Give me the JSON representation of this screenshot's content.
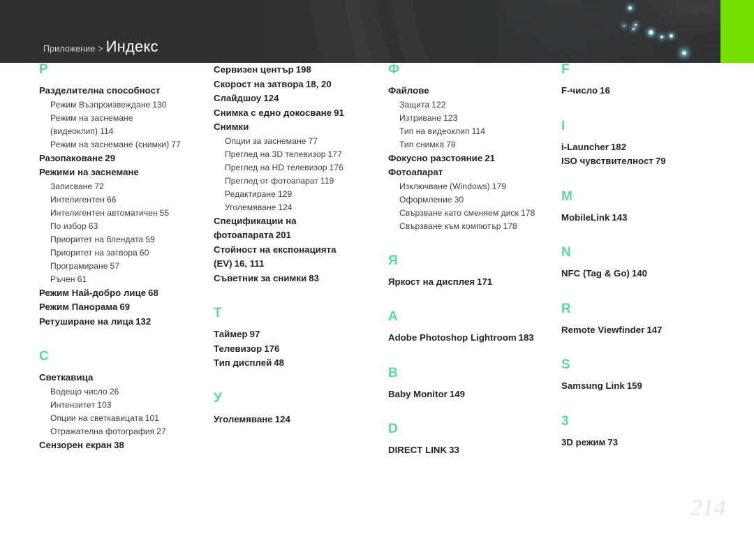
{
  "header": {
    "breadcrumb_parent": "Приложение",
    "breadcrumb_separator": ">",
    "breadcrumb_current": "Индекс",
    "accent_green": "#76e000",
    "background": "#303233"
  },
  "page_number": "214",
  "letter_color": "#5fd79b",
  "columns": [
    {
      "id": "column-1",
      "blocks": [
        {
          "letter": "Р",
          "entries": [
            {
              "label": "Разделителна способност",
              "page": ""
            },
            {
              "label": "Режим Възпроизвеждане",
              "page": "130",
              "sub": true
            },
            {
              "label": "Режим на заснемане",
              "page": "",
              "sub": true
            },
            {
              "label": "(видеоклип)",
              "page": "114",
              "sub": true
            },
            {
              "label": "Режим на заснемане (снимки)",
              "page": "77",
              "sub": true
            },
            {
              "label": "Разопаковане",
              "page": "29"
            },
            {
              "label": "Режими на заснемане",
              "page": ""
            },
            {
              "label": "Записване",
              "page": "72",
              "sub": true
            },
            {
              "label": "Интелигентен",
              "page": "66",
              "sub": true
            },
            {
              "label": "Интелигентен автоматичен",
              "page": "55",
              "sub": true
            },
            {
              "label": "По избор",
              "page": "63",
              "sub": true
            },
            {
              "label": "Приоритет на блендата",
              "page": "59",
              "sub": true
            },
            {
              "label": "Приоритет на затвора",
              "page": "60",
              "sub": true
            },
            {
              "label": "Програмиране",
              "page": "57",
              "sub": true
            },
            {
              "label": "Ръчен",
              "page": "61",
              "sub": true
            },
            {
              "label": "Режим Най-добро лице",
              "page": "68"
            },
            {
              "label": "Режим Панорама",
              "page": "69"
            },
            {
              "label": "Ретуширане на лица",
              "page": "132"
            }
          ]
        },
        {
          "letter": "С",
          "entries": [
            {
              "label": "Светкавица",
              "page": ""
            },
            {
              "label": "Водещо число",
              "page": "26",
              "sub": true
            },
            {
              "label": "Интензитет",
              "page": "103",
              "sub": true
            },
            {
              "label": "Опции на светкавицата",
              "page": "101",
              "sub": true
            },
            {
              "label": "Отражателна фотография",
              "page": "27",
              "sub": true
            },
            {
              "label": "Сензорен екран",
              "page": "38"
            }
          ]
        }
      ]
    },
    {
      "id": "column-2",
      "blocks": [
        {
          "letter": "",
          "entries": [
            {
              "label": "Сервизен център",
              "page": "198"
            },
            {
              "label": "Скорост на затвора",
              "page": "18, 20"
            },
            {
              "label": "Слайдшоу",
              "page": "124"
            },
            {
              "label": "Снимка с едно докосване",
              "page": "91"
            },
            {
              "label": "Снимки",
              "page": ""
            },
            {
              "label": "Опции за заснемане",
              "page": "77",
              "sub": true
            },
            {
              "label": "Преглед на 3D телевизор",
              "page": "177",
              "sub": true
            },
            {
              "label": "Преглед на HD телевизор",
              "page": "176",
              "sub": true
            },
            {
              "label": "Преглед от фотоапарат",
              "page": "119",
              "sub": true
            },
            {
              "label": "Редактиране",
              "page": "129",
              "sub": true
            },
            {
              "label": "Уголемяване",
              "page": "124",
              "sub": true
            },
            {
              "label": "Спецификации на",
              "page": ""
            },
            {
              "label": "фотоапарата",
              "page": "201"
            },
            {
              "label": "Стойност на експонацията",
              "page": ""
            },
            {
              "label": "(EV)",
              "page": "16, 111"
            },
            {
              "label": "Съветник за снимки",
              "page": "83"
            }
          ]
        },
        {
          "letter": "Т",
          "entries": [
            {
              "label": "Таймер",
              "page": "97"
            },
            {
              "label": "Телевизор",
              "page": "176"
            },
            {
              "label": "Тип дисплей",
              "page": "48"
            }
          ]
        },
        {
          "letter": "У",
          "entries": [
            {
              "label": "Уголемяване",
              "page": "124"
            }
          ]
        }
      ]
    },
    {
      "id": "column-3",
      "blocks": [
        {
          "letter": "Ф",
          "entries": [
            {
              "label": "Файлове",
              "page": ""
            },
            {
              "label": "Защита",
              "page": "122",
              "sub": true
            },
            {
              "label": "Изтриване",
              "page": "123",
              "sub": true
            },
            {
              "label": "Тип на видеоклип",
              "page": "114",
              "sub": true
            },
            {
              "label": "Тип снимка",
              "page": "78",
              "sub": true
            },
            {
              "label": "Фокусно разстояние",
              "page": "21"
            },
            {
              "label": "Фотоапарат",
              "page": ""
            },
            {
              "label": "Изключване (Windows)",
              "page": "179",
              "sub": true
            },
            {
              "label": "Оформление",
              "page": "30",
              "sub": true
            },
            {
              "label": "Свързване като сменяем диск",
              "page": "178",
              "sub": true
            },
            {
              "label": "Свързване към компютър",
              "page": "178",
              "sub": true
            }
          ]
        },
        {
          "letter": "Я",
          "entries": [
            {
              "label": "Яркост на дисплея",
              "page": "171"
            }
          ]
        },
        {
          "letter": "A",
          "entries": [
            {
              "label": "Adobe Photoshop Lightroom",
              "page": "183"
            }
          ]
        },
        {
          "letter": "B",
          "entries": [
            {
              "label": "Baby Monitor",
              "page": "149"
            }
          ]
        },
        {
          "letter": "D",
          "entries": [
            {
              "label": "DIRECT LINK",
              "page": "33"
            }
          ]
        }
      ]
    },
    {
      "id": "column-4",
      "blocks": [
        {
          "letter": "F",
          "entries": [
            {
              "label": "F-число",
              "page": "16"
            }
          ]
        },
        {
          "letter": "I",
          "entries": [
            {
              "label": "i-Launcher",
              "page": "182"
            },
            {
              "label": "ISO чувствителност",
              "page": "79"
            }
          ]
        },
        {
          "letter": "M",
          "entries": [
            {
              "label": "MobileLink",
              "page": "143"
            }
          ]
        },
        {
          "letter": "N",
          "entries": [
            {
              "label": "NFC (Tag & Go)",
              "page": "140"
            }
          ]
        },
        {
          "letter": "R",
          "entries": [
            {
              "label": "Remote Viewfinder",
              "page": "147"
            }
          ]
        },
        {
          "letter": "S",
          "entries": [
            {
              "label": "Samsung Link",
              "page": "159"
            }
          ]
        },
        {
          "letter": "3",
          "entries": [
            {
              "label": "3D режим",
              "page": "73"
            }
          ]
        }
      ]
    }
  ]
}
